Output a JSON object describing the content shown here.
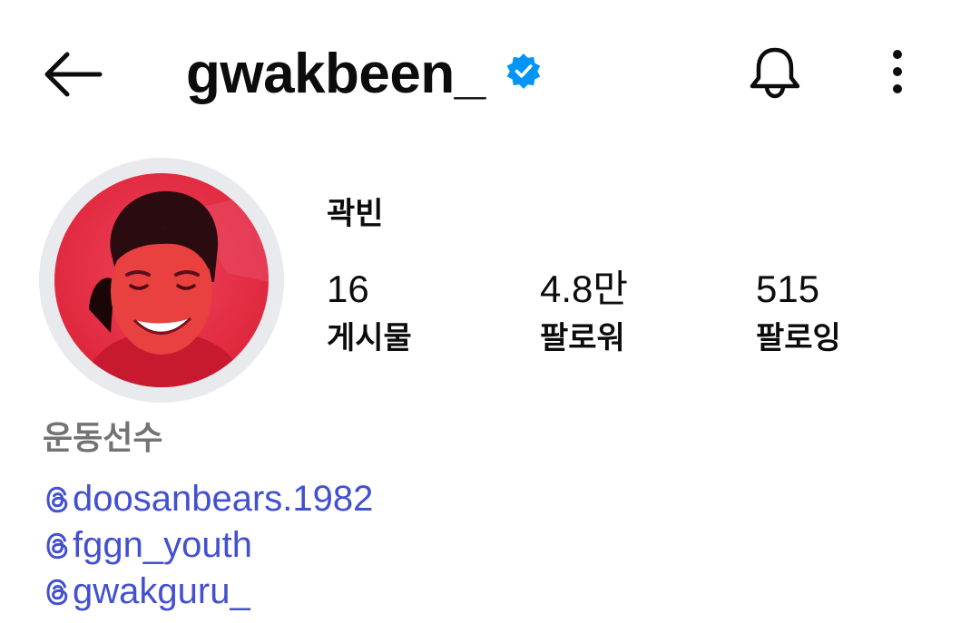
{
  "header": {
    "username": "gwakbeen_",
    "verified": true,
    "icons": {
      "back": "back-arrow-icon",
      "verified": "verified-badge-icon",
      "bell": "bell-icon",
      "more": "more-vertical-icon"
    },
    "accent_color": "#0095f6"
  },
  "profile": {
    "display_name": "곽빈",
    "avatar": "profile-photo"
  },
  "stats": {
    "posts": {
      "value": "16",
      "label": "게시물"
    },
    "followers": {
      "value": "4.8만",
      "label": "팔로워"
    },
    "following": {
      "value": "515",
      "label": "팔로잉"
    }
  },
  "bio": {
    "category": "운동선수",
    "category_color": "#737373",
    "link_color": "#4350cf",
    "links": [
      {
        "icon": "threads-icon",
        "text": "doosanbears.1982"
      },
      {
        "icon": "threads-icon",
        "text": "fggn_youth"
      },
      {
        "icon": "threads-icon",
        "text": "gwakguru_"
      }
    ]
  }
}
